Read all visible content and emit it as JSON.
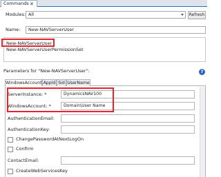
{
  "window": {
    "tab_label": "Commands",
    "close_glyph": "✕"
  },
  "modules": {
    "label": "Modules:",
    "selected": "All"
  },
  "refresh_label": "Refresh",
  "name": {
    "label": "Name:",
    "value": "New-NAVServerUser"
  },
  "command_list": [
    "New-NAVServerUser",
    "New-NAVServerUserPermissionSet"
  ],
  "parameters": {
    "label": "Parameters for \"New-NAVServerUser\":",
    "help_glyph": "?"
  },
  "param_tabs": [
    "WindowsAccount",
    "AppId",
    "Sid",
    "UserName"
  ],
  "fields": {
    "server_instance": {
      "label": "ServerInstance: *",
      "value": "DynamicsNAV100"
    },
    "windows_account": {
      "label": "WindowsAccount: *",
      "value": "Domain\\User Name"
    },
    "auth_email": {
      "label": "AuthenticationEmail:",
      "value": ""
    },
    "auth_key": {
      "label": "AuthenticationKey:",
      "value": ""
    },
    "contact_email": {
      "label": "ContactEmail:",
      "value": ""
    }
  },
  "checkboxes": {
    "change_password": "ChangePasswordAtNextLogOn",
    "confirm": "Confirm",
    "create_web_services_key": "CreateWebServicesKey"
  },
  "colors": {
    "highlight": "#e3242b",
    "accent": "#2d6fb5",
    "help_icon": "#2b67c1"
  }
}
